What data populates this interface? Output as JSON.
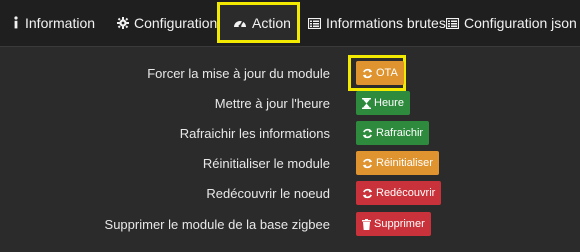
{
  "tabs": [
    {
      "label": "Information",
      "icon": "info-icon"
    },
    {
      "label": "Configuration",
      "icon": "gear-icon"
    },
    {
      "label": "Action",
      "icon": "gauge-icon"
    },
    {
      "label": "Informations brutes",
      "icon": "list-icon"
    },
    {
      "label": "Configuration json",
      "icon": "list-icon"
    }
  ],
  "active_tab": "Action",
  "actions": [
    {
      "label": "Forcer la mise à jour du module",
      "button": "OTA",
      "icon": "refresh-icon",
      "color": "#e0942f"
    },
    {
      "label": "Mettre à jour l'heure",
      "button": "Heure",
      "icon": "hourglass-icon",
      "color": "#2e8b3e"
    },
    {
      "label": "Rafraichir les informations",
      "button": "Rafraichir",
      "icon": "refresh-icon",
      "color": "#2e8b3e"
    },
    {
      "label": "Réinitialiser le module",
      "button": "Réinitialiser",
      "icon": "refresh-icon",
      "color": "#e0942f"
    },
    {
      "label": "Redécouvrir le noeud",
      "button": "Redécouvrir",
      "icon": "refresh-icon",
      "color": "#c9323a"
    },
    {
      "label": "Supprimer le module de la base zigbee",
      "button": "Supprimer",
      "icon": "trash-icon",
      "color": "#c9323a"
    }
  ],
  "colors": {
    "highlight": "#f2ea00",
    "background": "#2b2b2b",
    "tabbar": "#1f1f1f"
  }
}
